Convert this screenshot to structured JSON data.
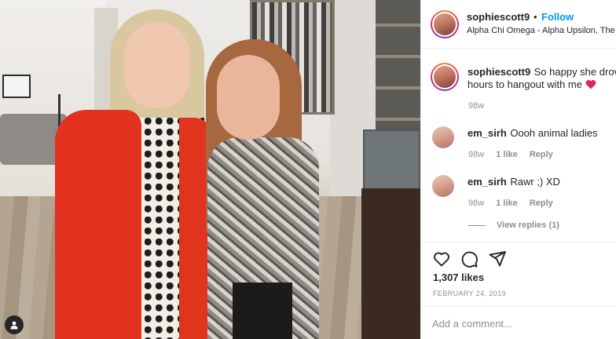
{
  "post": {
    "username": "sophiescott9",
    "separator": "•",
    "follow_label": "Follow",
    "location": "Alpha Chi Omega - Alpha Upsilon, The"
  },
  "caption": {
    "username": "sophiescott9",
    "text_line1": "So happy she drove",
    "text_line2": "hours to hangout with me",
    "emoji": "heart-icon",
    "age": "98w"
  },
  "comments": [
    {
      "username": "em_sirh",
      "text": "Oooh animal ladies",
      "age": "98w",
      "likes": "1 like",
      "reply_label": "Reply"
    },
    {
      "username": "em_sirh",
      "text": "Rawr ;) XD",
      "age": "98w",
      "likes": "1 like",
      "reply_label": "Reply"
    }
  ],
  "view_replies_label": "View replies (1)",
  "actions": {
    "like_icon": "heart-outline-icon",
    "comment_icon": "comment-icon",
    "share_icon": "share-icon"
  },
  "likes_label": "1,307 likes",
  "date": "FEBRUARY 24, 2019",
  "add_comment": {
    "placeholder": "Add a comment..."
  },
  "colors": {
    "follow": "#0095f6",
    "meta": "#8e8e8e",
    "heart": "#ed4956",
    "cardigan": "#e2321f"
  }
}
